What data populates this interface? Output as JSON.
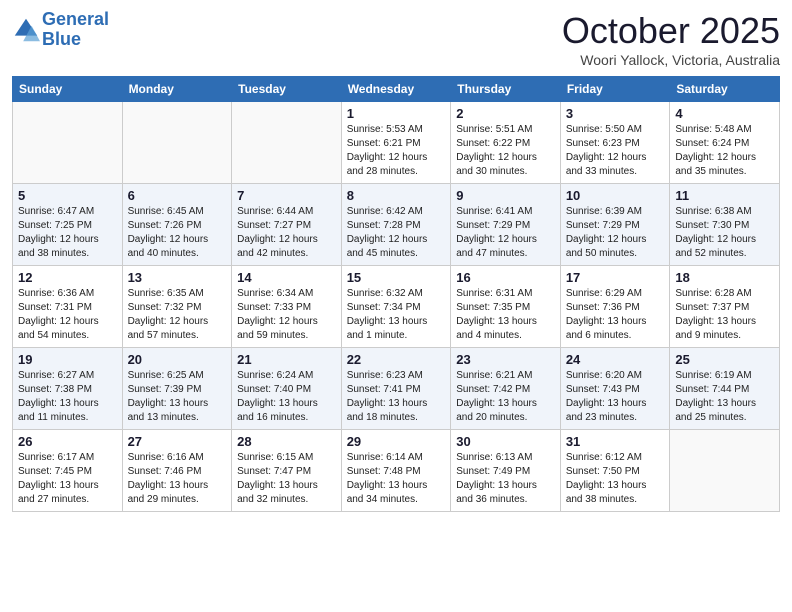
{
  "header": {
    "logo_line1": "General",
    "logo_line2": "Blue",
    "month": "October 2025",
    "location": "Woori Yallock, Victoria, Australia"
  },
  "weekdays": [
    "Sunday",
    "Monday",
    "Tuesday",
    "Wednesday",
    "Thursday",
    "Friday",
    "Saturday"
  ],
  "weeks": [
    [
      {
        "day": "",
        "info": ""
      },
      {
        "day": "",
        "info": ""
      },
      {
        "day": "",
        "info": ""
      },
      {
        "day": "1",
        "info": "Sunrise: 5:53 AM\nSunset: 6:21 PM\nDaylight: 12 hours\nand 28 minutes."
      },
      {
        "day": "2",
        "info": "Sunrise: 5:51 AM\nSunset: 6:22 PM\nDaylight: 12 hours\nand 30 minutes."
      },
      {
        "day": "3",
        "info": "Sunrise: 5:50 AM\nSunset: 6:23 PM\nDaylight: 12 hours\nand 33 minutes."
      },
      {
        "day": "4",
        "info": "Sunrise: 5:48 AM\nSunset: 6:24 PM\nDaylight: 12 hours\nand 35 minutes."
      }
    ],
    [
      {
        "day": "5",
        "info": "Sunrise: 6:47 AM\nSunset: 7:25 PM\nDaylight: 12 hours\nand 38 minutes."
      },
      {
        "day": "6",
        "info": "Sunrise: 6:45 AM\nSunset: 7:26 PM\nDaylight: 12 hours\nand 40 minutes."
      },
      {
        "day": "7",
        "info": "Sunrise: 6:44 AM\nSunset: 7:27 PM\nDaylight: 12 hours\nand 42 minutes."
      },
      {
        "day": "8",
        "info": "Sunrise: 6:42 AM\nSunset: 7:28 PM\nDaylight: 12 hours\nand 45 minutes."
      },
      {
        "day": "9",
        "info": "Sunrise: 6:41 AM\nSunset: 7:29 PM\nDaylight: 12 hours\nand 47 minutes."
      },
      {
        "day": "10",
        "info": "Sunrise: 6:39 AM\nSunset: 7:29 PM\nDaylight: 12 hours\nand 50 minutes."
      },
      {
        "day": "11",
        "info": "Sunrise: 6:38 AM\nSunset: 7:30 PM\nDaylight: 12 hours\nand 52 minutes."
      }
    ],
    [
      {
        "day": "12",
        "info": "Sunrise: 6:36 AM\nSunset: 7:31 PM\nDaylight: 12 hours\nand 54 minutes."
      },
      {
        "day": "13",
        "info": "Sunrise: 6:35 AM\nSunset: 7:32 PM\nDaylight: 12 hours\nand 57 minutes."
      },
      {
        "day": "14",
        "info": "Sunrise: 6:34 AM\nSunset: 7:33 PM\nDaylight: 12 hours\nand 59 minutes."
      },
      {
        "day": "15",
        "info": "Sunrise: 6:32 AM\nSunset: 7:34 PM\nDaylight: 13 hours\nand 1 minute."
      },
      {
        "day": "16",
        "info": "Sunrise: 6:31 AM\nSunset: 7:35 PM\nDaylight: 13 hours\nand 4 minutes."
      },
      {
        "day": "17",
        "info": "Sunrise: 6:29 AM\nSunset: 7:36 PM\nDaylight: 13 hours\nand 6 minutes."
      },
      {
        "day": "18",
        "info": "Sunrise: 6:28 AM\nSunset: 7:37 PM\nDaylight: 13 hours\nand 9 minutes."
      }
    ],
    [
      {
        "day": "19",
        "info": "Sunrise: 6:27 AM\nSunset: 7:38 PM\nDaylight: 13 hours\nand 11 minutes."
      },
      {
        "day": "20",
        "info": "Sunrise: 6:25 AM\nSunset: 7:39 PM\nDaylight: 13 hours\nand 13 minutes."
      },
      {
        "day": "21",
        "info": "Sunrise: 6:24 AM\nSunset: 7:40 PM\nDaylight: 13 hours\nand 16 minutes."
      },
      {
        "day": "22",
        "info": "Sunrise: 6:23 AM\nSunset: 7:41 PM\nDaylight: 13 hours\nand 18 minutes."
      },
      {
        "day": "23",
        "info": "Sunrise: 6:21 AM\nSunset: 7:42 PM\nDaylight: 13 hours\nand 20 minutes."
      },
      {
        "day": "24",
        "info": "Sunrise: 6:20 AM\nSunset: 7:43 PM\nDaylight: 13 hours\nand 23 minutes."
      },
      {
        "day": "25",
        "info": "Sunrise: 6:19 AM\nSunset: 7:44 PM\nDaylight: 13 hours\nand 25 minutes."
      }
    ],
    [
      {
        "day": "26",
        "info": "Sunrise: 6:17 AM\nSunset: 7:45 PM\nDaylight: 13 hours\nand 27 minutes."
      },
      {
        "day": "27",
        "info": "Sunrise: 6:16 AM\nSunset: 7:46 PM\nDaylight: 13 hours\nand 29 minutes."
      },
      {
        "day": "28",
        "info": "Sunrise: 6:15 AM\nSunset: 7:47 PM\nDaylight: 13 hours\nand 32 minutes."
      },
      {
        "day": "29",
        "info": "Sunrise: 6:14 AM\nSunset: 7:48 PM\nDaylight: 13 hours\nand 34 minutes."
      },
      {
        "day": "30",
        "info": "Sunrise: 6:13 AM\nSunset: 7:49 PM\nDaylight: 13 hours\nand 36 minutes."
      },
      {
        "day": "31",
        "info": "Sunrise: 6:12 AM\nSunset: 7:50 PM\nDaylight: 13 hours\nand 38 minutes."
      },
      {
        "day": "",
        "info": ""
      }
    ]
  ]
}
